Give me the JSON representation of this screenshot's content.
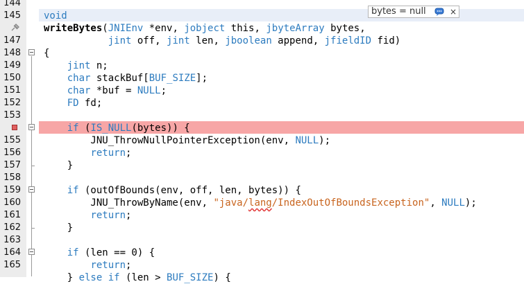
{
  "gutter": {
    "line_numbers": [
      "144",
      "145",
      "",
      "147",
      "148",
      "149",
      "150",
      "151",
      "152",
      "153",
      "",
      "155",
      "156",
      "157",
      "158",
      "159",
      "160",
      "161",
      "162",
      "163",
      "164",
      "165",
      ""
    ]
  },
  "tooltip": {
    "text": "bytes = null",
    "icon": "annotation-bubble-icon",
    "close": "×"
  },
  "code_lines": [
    [],
    [
      {
        "t": "void",
        "c": "kw"
      }
    ],
    [
      {
        "t": "writeBytes",
        "c": "bold"
      },
      {
        "t": "("
      },
      {
        "t": "JNIEnv",
        "c": "kw"
      },
      {
        "t": " *env, "
      },
      {
        "t": "jobject",
        "c": "kw"
      },
      {
        "t": " this, "
      },
      {
        "t": "jbyteArray",
        "c": "kw"
      },
      {
        "t": " bytes,"
      }
    ],
    [
      {
        "t": "           "
      },
      {
        "t": "jint",
        "c": "kw"
      },
      {
        "t": " off, "
      },
      {
        "t": "jint",
        "c": "kw"
      },
      {
        "t": " len, "
      },
      {
        "t": "jboolean",
        "c": "kw"
      },
      {
        "t": " append, "
      },
      {
        "t": "jfieldID",
        "c": "kw"
      },
      {
        "t": " fid)"
      }
    ],
    [
      {
        "t": "{"
      }
    ],
    [
      {
        "t": "    "
      },
      {
        "t": "jint",
        "c": "kw"
      },
      {
        "t": " n;"
      }
    ],
    [
      {
        "t": "    "
      },
      {
        "t": "char",
        "c": "kw"
      },
      {
        "t": " stackBuf["
      },
      {
        "t": "BUF_SIZE",
        "c": "kw"
      },
      {
        "t": "];"
      }
    ],
    [
      {
        "t": "    "
      },
      {
        "t": "char",
        "c": "kw"
      },
      {
        "t": " *buf = "
      },
      {
        "t": "NULL",
        "c": "kw"
      },
      {
        "t": ";"
      }
    ],
    [
      {
        "t": "    "
      },
      {
        "t": "FD",
        "c": "kw"
      },
      {
        "t": " fd;"
      }
    ],
    [],
    [
      {
        "t": "    "
      },
      {
        "t": "if",
        "c": "kw"
      },
      {
        "t": " ("
      },
      {
        "t": "IS_NULL",
        "c": "kw"
      },
      {
        "t": "(bytes)) {"
      }
    ],
    [
      {
        "t": "        JNU_ThrowNullPointerException(env, "
      },
      {
        "t": "NULL",
        "c": "kw"
      },
      {
        "t": ");"
      }
    ],
    [
      {
        "t": "        "
      },
      {
        "t": "return",
        "c": "kw"
      },
      {
        "t": ";"
      }
    ],
    [
      {
        "t": "    }"
      }
    ],
    [],
    [
      {
        "t": "    "
      },
      {
        "t": "if",
        "c": "kw"
      },
      {
        "t": " (outOfBounds(env, off, len, bytes)) {"
      }
    ],
    [
      {
        "t": "        JNU_ThrowByName(env, "
      },
      {
        "t": "\"java/",
        "c": "str"
      },
      {
        "t": "lang",
        "c": "str sq"
      },
      {
        "t": "/IndexOutOfBoundsException\"",
        "c": "str"
      },
      {
        "t": ", "
      },
      {
        "t": "NULL",
        "c": "kw"
      },
      {
        "t": ");"
      }
    ],
    [
      {
        "t": "        "
      },
      {
        "t": "return",
        "c": "kw"
      },
      {
        "t": ";"
      }
    ],
    [
      {
        "t": "    }"
      }
    ],
    [],
    [
      {
        "t": "    "
      },
      {
        "t": "if",
        "c": "kw"
      },
      {
        "t": " (len == 0) {"
      }
    ],
    [
      {
        "t": "        "
      },
      {
        "t": "return",
        "c": "kw"
      },
      {
        "t": ";"
      }
    ],
    [
      {
        "t": "    } "
      },
      {
        "t": "else",
        "c": "kw"
      },
      {
        "t": " "
      },
      {
        "t": "if",
        "c": "kw"
      },
      {
        "t": " (len > "
      },
      {
        "t": "BUF_SIZE",
        "c": "kw"
      },
      {
        "t": ") {"
      }
    ]
  ]
}
